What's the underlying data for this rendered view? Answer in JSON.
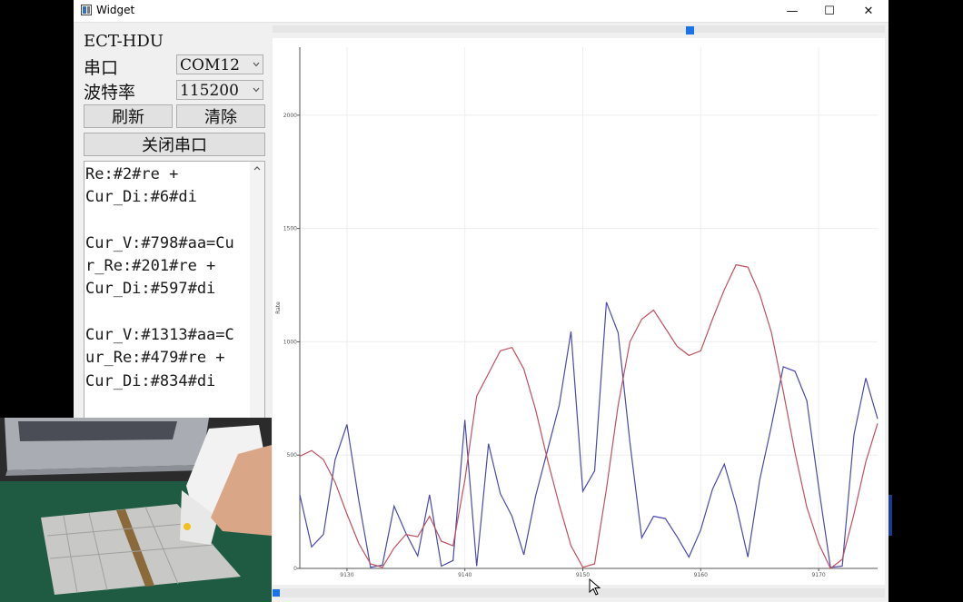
{
  "window": {
    "title": "Widget",
    "controls": {
      "minimize": "—",
      "maximize": "☐",
      "close": "✕"
    }
  },
  "panel": {
    "app_label": "ECT-HDU",
    "port_label": "串口",
    "port_value": "COM12",
    "baud_label": "波特率",
    "baud_value": "115200",
    "refresh_label": "刷新",
    "clear_label": "清除",
    "close_port_label": "关闭串口"
  },
  "log": {
    "text": "Re:#2#re +\nCur_Di:#6#di\n\nCur_V:#798#aa=Cu\nr_Re:#201#re +\nCur_Di:#597#di\n\nCur_V:#1313#aa=C\nur_Re:#479#re +\nCur_Di:#834#di"
  },
  "chart_data": {
    "type": "line",
    "ylabel": "Rate",
    "xlim": [
      9126,
      9175
    ],
    "ylim": [
      0,
      2300
    ],
    "y_ticks": [
      0,
      500,
      1000,
      1500,
      2000
    ],
    "x_ticks": [
      9130,
      9140,
      9150,
      9160,
      9170
    ],
    "grid": true,
    "colors": {
      "blue_series": "#4a4aa8",
      "red_series": "#c05060"
    },
    "x": [
      9126,
      9127,
      9128,
      9129,
      9130,
      9131,
      9132,
      9133,
      9134,
      9135,
      9136,
      9137,
      9138,
      9139,
      9140,
      9141,
      9142,
      9143,
      9144,
      9145,
      9146,
      9147,
      9148,
      9149,
      9150,
      9151,
      9152,
      9153,
      9154,
      9155,
      9156,
      9157,
      9158,
      9159,
      9160,
      9161,
      9162,
      9163,
      9164,
      9165,
      9166,
      9167,
      9168,
      9169,
      9170,
      9171,
      9172,
      9173,
      9174,
      9175
    ],
    "series": [
      {
        "values": [
          325,
          95,
          150,
          480,
          635,
          300,
          5,
          15,
          275,
          155,
          55,
          325,
          10,
          35,
          655,
          10,
          550,
          330,
          230,
          60,
          320,
          520,
          720,
          1045,
          340,
          430,
          1175,
          1040,
          555,
          135,
          230,
          220,
          140,
          50,
          170,
          350,
          460,
          280,
          50,
          390,
          630,
          890,
          870,
          740,
          360,
          5,
          10,
          590,
          840,
          660
        ]
      },
      {
        "values": [
          495,
          520,
          480,
          380,
          240,
          110,
          20,
          5,
          90,
          150,
          140,
          230,
          120,
          100,
          390,
          760,
          860,
          960,
          975,
          880,
          700,
          480,
          280,
          100,
          5,
          20,
          350,
          720,
          1000,
          1100,
          1140,
          1060,
          980,
          940,
          960,
          1100,
          1230,
          1340,
          1330,
          1210,
          1040,
          780,
          510,
          270,
          110,
          0,
          40,
          240,
          470,
          640
        ]
      }
    ]
  }
}
